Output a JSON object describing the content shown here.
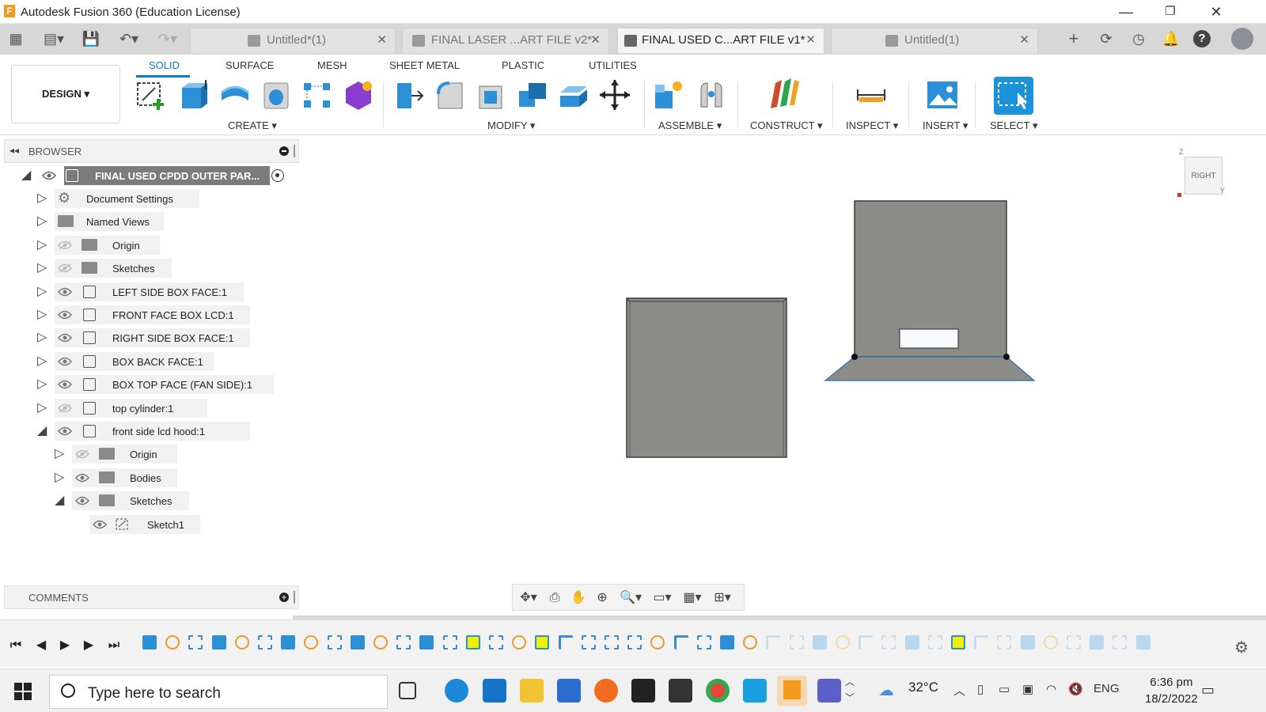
{
  "window": {
    "title": "Autodesk Fusion 360 (Education License)",
    "logo": "F",
    "minimize": "—",
    "restore": "❐",
    "close": "✕"
  },
  "tabs": [
    {
      "label": "Untitled*(1)",
      "active": false
    },
    {
      "label": "FINAL LASER ...ART FILE v2*",
      "active": false
    },
    {
      "label": "FINAL USED C...ART FILE v1*",
      "active": true
    },
    {
      "label": "Untitled(1)",
      "active": false
    }
  ],
  "ribbon": {
    "tabs": [
      "SOLID",
      "SURFACE",
      "MESH",
      "SHEET METAL",
      "PLASTIC",
      "UTILITIES"
    ],
    "active_tab": "SOLID",
    "workspace": "DESIGN ▾",
    "groups": [
      "CREATE ▾",
      "MODIFY ▾",
      "ASSEMBLE ▾",
      "CONSTRUCT ▾",
      "INSPECT ▾",
      "INSERT ▾",
      "SELECT ▾"
    ]
  },
  "browser": {
    "title": "BROWSER",
    "root": "FINAL USED CPDD OUTER PAR...",
    "items": [
      {
        "label": "Document Settings",
        "icon": "gear-icon",
        "expanded": false,
        "visible": null
      },
      {
        "label": "Named Views",
        "icon": "folder-icon",
        "expanded": false,
        "visible": null
      },
      {
        "label": "Origin",
        "icon": "folder-icon",
        "expanded": false,
        "visible": false
      },
      {
        "label": "Sketches",
        "icon": "folder-icon",
        "expanded": false,
        "visible": false
      },
      {
        "label": "LEFT SIDE BOX FACE:1",
        "icon": "component-icon",
        "expanded": false,
        "visible": true
      },
      {
        "label": "FRONT FACE  BOX LCD:1",
        "icon": "component-icon",
        "expanded": false,
        "visible": true
      },
      {
        "label": "RIGHT SIDE BOX FACE:1",
        "icon": "component-icon",
        "expanded": false,
        "visible": true
      },
      {
        "label": "BOX BACK FACE:1",
        "icon": "component-icon",
        "expanded": false,
        "visible": true
      },
      {
        "label": "BOX TOP FACE (FAN SIDE):1",
        "icon": "component-icon",
        "expanded": false,
        "visible": true
      },
      {
        "label": "top cylinder:1",
        "icon": "component-icon",
        "expanded": false,
        "visible": false
      },
      {
        "label": "front side lcd hood:1",
        "icon": "component-icon",
        "expanded": true,
        "visible": true
      },
      {
        "label": "Origin",
        "icon": "folder-icon",
        "expanded": false,
        "visible": false
      },
      {
        "label": "Bodies",
        "icon": "folder-icon",
        "expanded": false,
        "visible": true
      },
      {
        "label": "Sketches",
        "icon": "folder-icon",
        "expanded": true,
        "visible": true
      },
      {
        "label": "Sketch1",
        "icon": "sketch-icon",
        "expanded": null,
        "visible": true
      }
    ]
  },
  "viewcube": {
    "face": "RIGHT",
    "axis_z": "Z",
    "axis_y": "Y"
  },
  "comments": {
    "title": "COMMENTS"
  },
  "taskbar": {
    "search_placeholder": "Type here to search",
    "weather": "32°C",
    "language": "ENG",
    "time": "6:36 pm",
    "date": "18/2/2022"
  },
  "colors": {
    "accent": "#0a7bc1",
    "body_gray": "#8a8b87",
    "tab_bar": "#d7d7d7",
    "highlight": "#f0f000",
    "fusion_orange": "#f39a1c"
  }
}
